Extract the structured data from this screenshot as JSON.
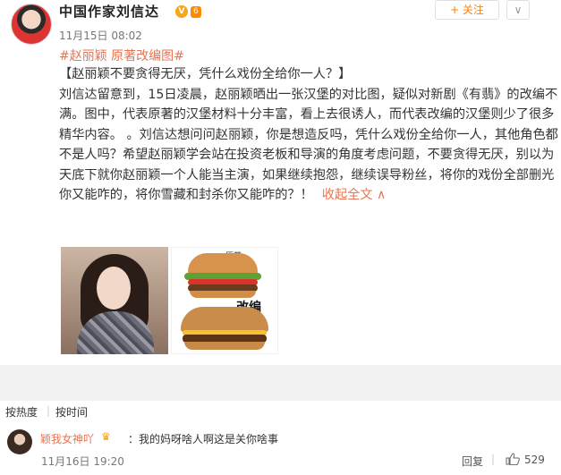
{
  "author": {
    "name": "中国作家刘信达",
    "vip_icon": "vip-badge-icon",
    "level_text": "6"
  },
  "actions": {
    "follow_label": "+ 关注",
    "more_label": "∨"
  },
  "post": {
    "time": "11月15日 08:02",
    "topics": "#赵丽颖 原著改编图#",
    "headline": "【赵丽颖不要贪得无厌，凭什么戏份全给你一人？】",
    "body": "刘信达留意到，15日凌晨，赵丽颖晒出一张汉堡的对比图，疑似对新剧《有翡》的改编不满。图中，代表原著的汉堡材料十分丰富，看上去很诱人，而代表改编的汉堡则少了很多精华内容。 。刘信达想问问赵丽颖，你是想造反吗，凭什么戏份全给你一人，其他角色都不是人吗？希望赵丽颖学会站在投资老板和导演的角度考虑问题，不要贪得无厌，别以为天底下就你赵丽颖一个人能当主演，如果继续抱怨，继续误导粉丝，将你的戏份全部删光你又能咋的，将你雪藏和封杀你又能咋的？！",
    "collapse_label": "收起全文 ∧",
    "image_label_original": "原著",
    "image_label_adapted": "改编"
  },
  "comments_header": {
    "tab_hot": "按热度",
    "tab_time": "按时间"
  },
  "comments": [
    {
      "user": "颖我女神吖",
      "text": "：我的妈呀啥人啊这是关你啥事",
      "time": "11月16日 19:20",
      "reply_label": "回复",
      "likes": "529"
    }
  ]
}
